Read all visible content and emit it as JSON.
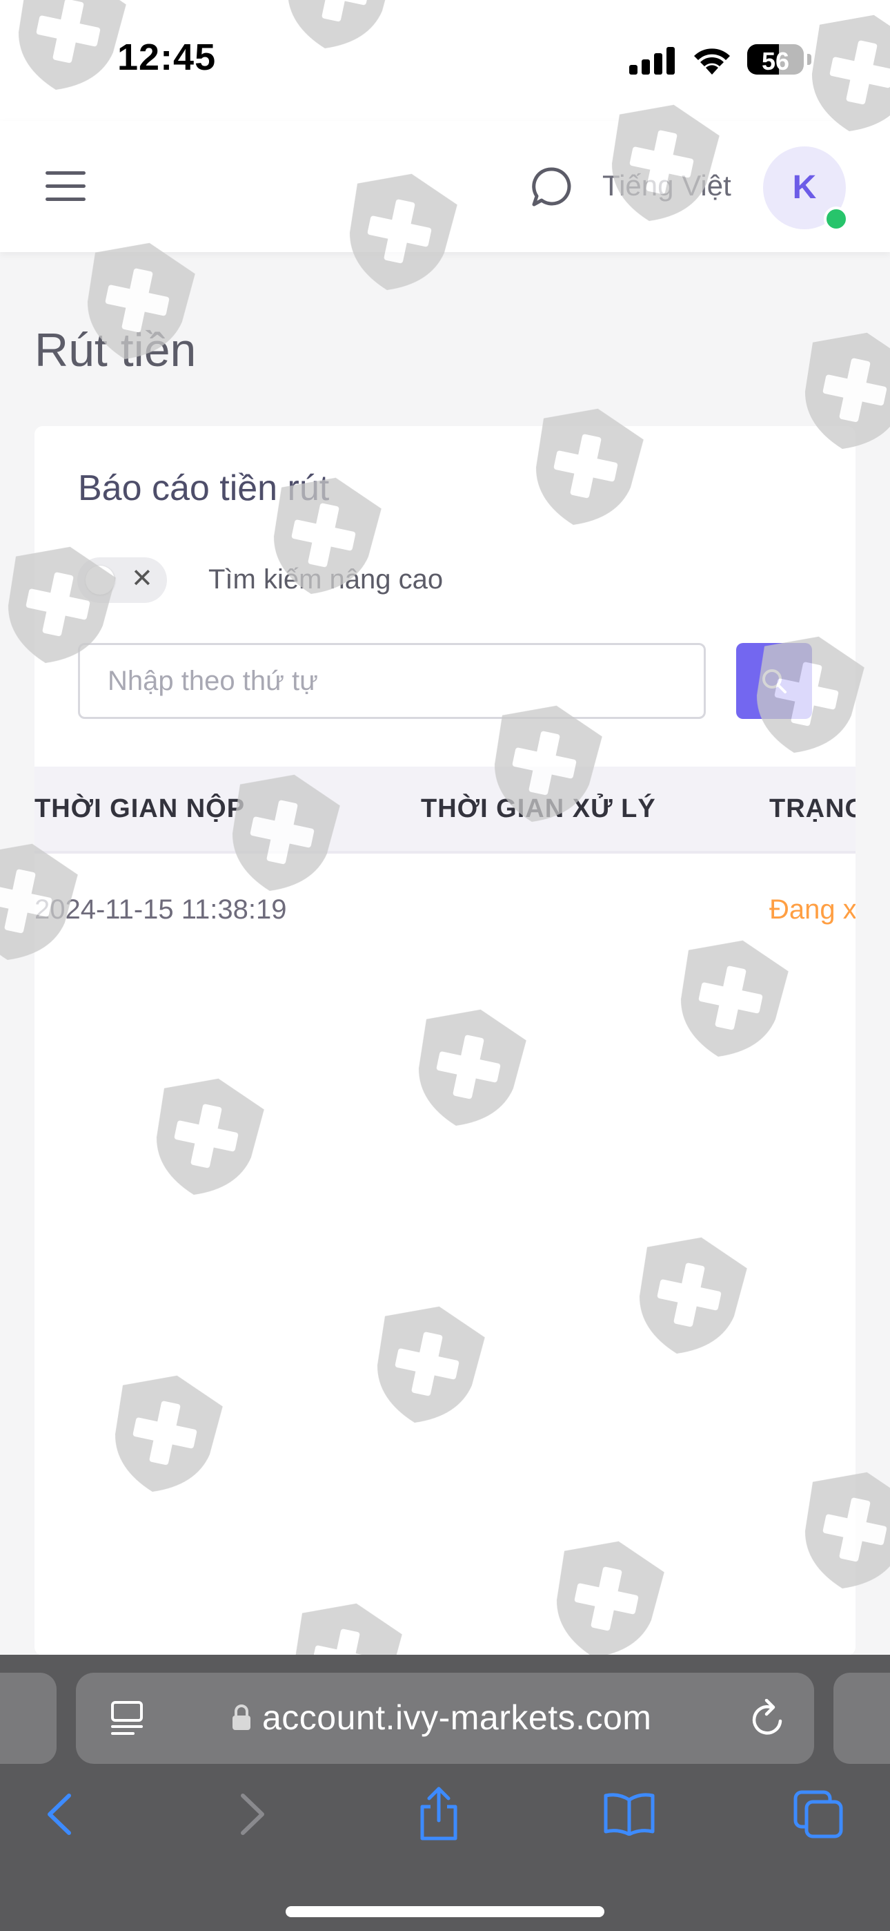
{
  "status_bar": {
    "time": "12:45",
    "battery": "56",
    "battery_level": 0.56
  },
  "header": {
    "language": "Tiếng Việt",
    "avatar_initial": "K",
    "online_color": "#27c46b"
  },
  "page": {
    "title": "Rút tiền"
  },
  "card": {
    "title": "Báo cáo tiền rút",
    "advanced_search_label": "Tìm kiếm nâng cao",
    "advanced_search_enabled": false,
    "search_placeholder": "Nhập theo thứ tự",
    "search_value": "",
    "table": {
      "columns": [
        "THỜI GIAN NỘP",
        "THỜI GIAN XỬ LÝ",
        "TRẠNG"
      ],
      "rows": [
        {
          "submit_time": "2024-11-15 11:38:19",
          "process_time": "",
          "status": "Đang x"
        }
      ]
    }
  },
  "browser": {
    "url": "account.ivy-markets.com"
  },
  "colors": {
    "accent": "#7367f0",
    "status_pending": "#ff9f43",
    "browser_chrome": "#5a5a5c",
    "browser_blue": "#3d8bff"
  }
}
